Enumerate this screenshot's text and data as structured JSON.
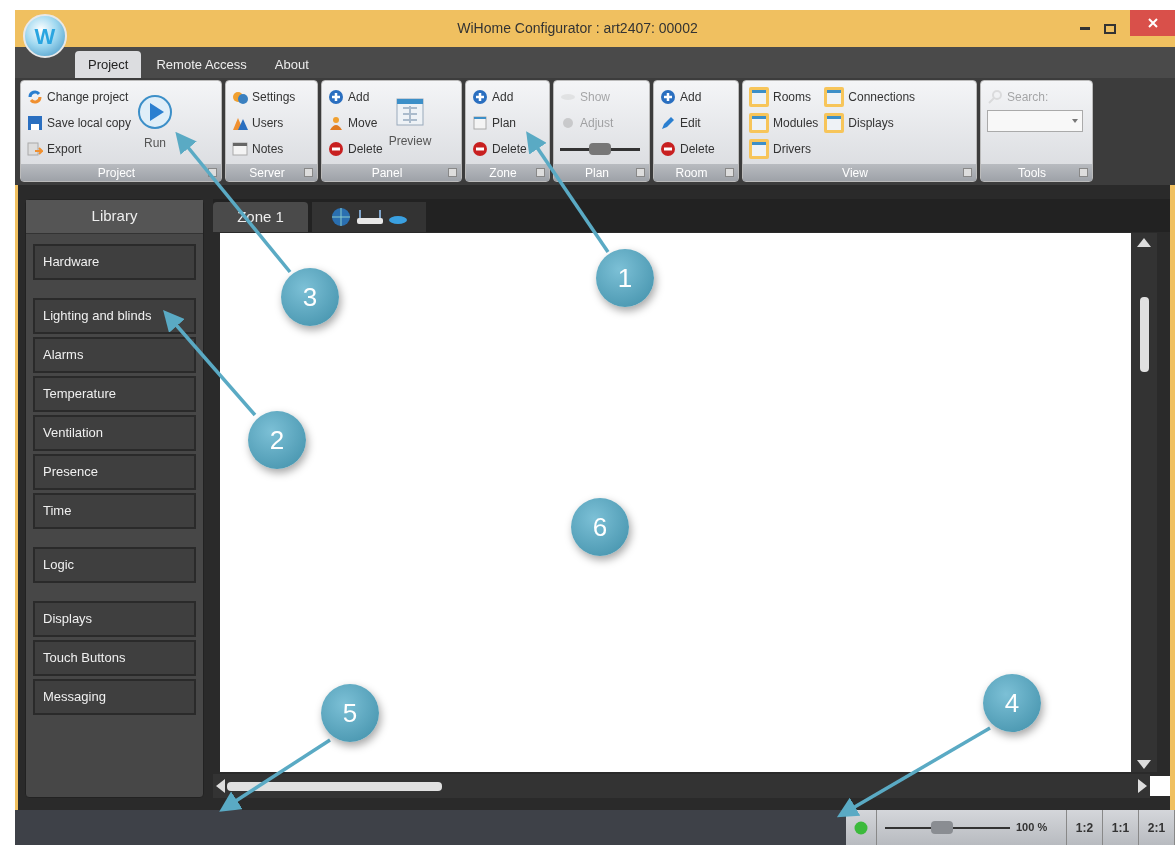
{
  "window": {
    "logo": "W",
    "title": "WiHome Configurator : art2407: 00002"
  },
  "ribbon_tabs": [
    {
      "label": "Project",
      "selected": true
    },
    {
      "label": "Remote Access",
      "selected": false
    },
    {
      "label": "About",
      "selected": false
    }
  ],
  "ribbon_groups": [
    {
      "label": "Project",
      "items": [
        {
          "kind": "button",
          "label": "Change project",
          "disabled": false
        },
        {
          "kind": "button",
          "label": "Save local copy",
          "disabled": false
        },
        {
          "kind": "button",
          "label": "Export",
          "disabled": false
        },
        {
          "kind": "large",
          "label": "Run",
          "disabled": false
        }
      ]
    },
    {
      "label": "Server",
      "items": [
        {
          "kind": "button",
          "label": "Settings",
          "disabled": false
        },
        {
          "kind": "button",
          "label": "Users",
          "disabled": false
        },
        {
          "kind": "button",
          "label": "Notes",
          "disabled": false
        }
      ]
    },
    {
      "label": "Panel",
      "items": [
        {
          "kind": "button",
          "label": "Add",
          "disabled": false
        },
        {
          "kind": "button",
          "label": "Move",
          "disabled": false
        },
        {
          "kind": "button",
          "label": "Delete",
          "disabled": false
        },
        {
          "kind": "large",
          "label": "Preview",
          "disabled": false
        }
      ]
    },
    {
      "label": "Zone",
      "items": [
        {
          "kind": "button",
          "label": "Add",
          "disabled": false
        },
        {
          "kind": "button",
          "label": "Plan",
          "disabled": false
        },
        {
          "kind": "button",
          "label": "Delete",
          "disabled": false
        }
      ]
    },
    {
      "label": "Plan",
      "items": [
        {
          "kind": "button",
          "label": "Show",
          "disabled": true
        },
        {
          "kind": "button",
          "label": "Adjust",
          "disabled": true
        },
        {
          "kind": "slider",
          "level": 0.5,
          "disabled": false
        }
      ]
    },
    {
      "label": "Room",
      "items": [
        {
          "kind": "button",
          "label": "Add",
          "disabled": false
        },
        {
          "kind": "button",
          "label": "Edit",
          "disabled": false
        },
        {
          "kind": "button",
          "label": "Delete",
          "disabled": false
        }
      ]
    },
    {
      "label": "View",
      "items": [
        {
          "kind": "toggle",
          "label": "Rooms",
          "disabled": false
        },
        {
          "kind": "toggle",
          "label": "Modules",
          "disabled": false
        },
        {
          "kind": "toggle",
          "label": "Drivers",
          "disabled": false
        },
        {
          "kind": "toggle",
          "label": "Connections",
          "disabled": false
        },
        {
          "kind": "toggle",
          "label": "Displays",
          "disabled": false
        }
      ]
    },
    {
      "label": "Tools",
      "items": [
        {
          "kind": "button",
          "label": "Search:",
          "disabled": true
        },
        {
          "kind": "combo",
          "disabled": false
        }
      ]
    }
  ],
  "library": {
    "title": "Library",
    "sections": [
      {
        "items": [
          "Hardware"
        ]
      },
      {
        "items": [
          "Lighting and blinds",
          "Alarms",
          "Temperature",
          "Ventilation",
          "Presence",
          "Time"
        ]
      },
      {
        "items": [
          "Logic"
        ]
      },
      {
        "items": [
          "Displays",
          "Touch Buttons",
          "Messaging"
        ]
      }
    ]
  },
  "document_tabs": [
    {
      "label": "Zone 1",
      "selected": true
    }
  ],
  "status_bar": {
    "zoom": {
      "level": 0.45,
      "reading": "100 %"
    },
    "ratio_buttons": [
      "1:2",
      "1:1",
      "2:1"
    ]
  },
  "callouts": [
    {
      "label": "1"
    },
    {
      "label": "2"
    },
    {
      "label": "3"
    },
    {
      "label": "4"
    },
    {
      "label": "5"
    },
    {
      "label": "6"
    }
  ]
}
